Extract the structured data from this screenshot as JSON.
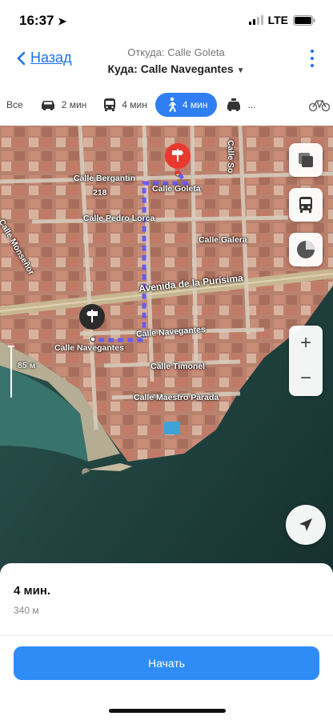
{
  "status": {
    "time": "16:37",
    "network": "LTE"
  },
  "header": {
    "back_label": "Назад",
    "from": "Откуда: Calle Goleta",
    "to": "Куда: Calle Navegantes"
  },
  "modes": [
    {
      "label": "Все",
      "icon": "none"
    },
    {
      "label": "2 мин",
      "icon": "car-icon"
    },
    {
      "label": "4 мин",
      "icon": "bus-icon"
    },
    {
      "label": "4 мин",
      "icon": "walk-icon",
      "active": true
    },
    {
      "label": "...",
      "icon": "taxi-icon"
    },
    {
      "label": "",
      "icon": "bicycle-icon"
    }
  ],
  "map": {
    "labels": [
      "Calle Bergantin",
      "218",
      "Calle Goleta",
      "Calle Pedro Lorca",
      "Calle Galera",
      "Avenida de la Purísima",
      "Calle Navegantes",
      "Calle Navegantes",
      "Calle Timonel",
      "Calle Maestro Parada",
      "Calle So",
      "Calle Monseñor",
      "85 м"
    ],
    "zoom_in": "+",
    "zoom_out": "−"
  },
  "sheet": {
    "duration": "4 мин.",
    "distance": "340 м",
    "start_label": "Начать"
  },
  "colors": {
    "accent": "#2f7ff3",
    "route": "#6a5cf0",
    "destination_pin": "#e8392f"
  }
}
